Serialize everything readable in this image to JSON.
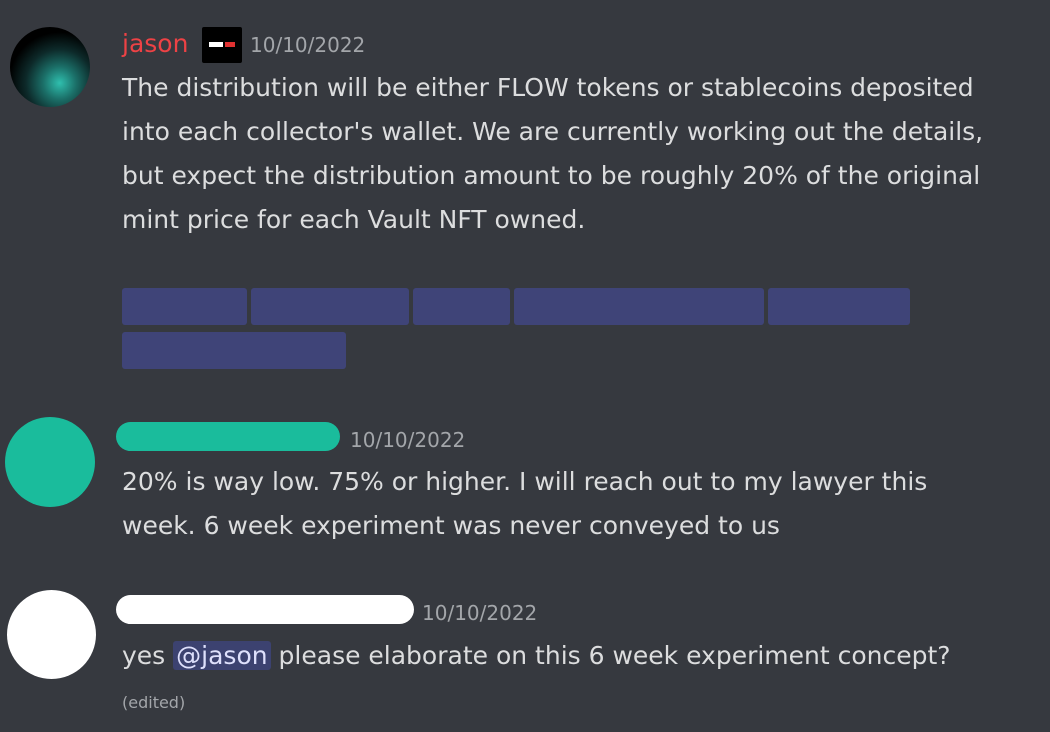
{
  "messages": [
    {
      "author": "jason",
      "author_color": "#ed4245",
      "badge": "vault-logo-badge",
      "timestamp": "10/10/2022",
      "lines": [
        "The distribution will be either FLOW tokens or stablecoins deposited",
        "into each collector's wallet. We are currently working out the details,",
        "but expect the distribution amount to be roughly 20% of the original",
        "mint price for each Vault NFT owned."
      ]
    },
    {
      "author_color": "#1abc9c",
      "timestamp": "10/10/2022",
      "lines": [
        "20% is way low. 75% or higher. I will reach out to my lawyer this",
        "week. 6 week experiment was never conveyed to us"
      ]
    },
    {
      "author_color": "#ffffff",
      "timestamp": "10/10/2022",
      "text_before_mention": "yes",
      "mention": "@jason",
      "text_after_mention": "please elaborate on this 6 week experiment concept?",
      "edited_label": "(edited)"
    }
  ]
}
